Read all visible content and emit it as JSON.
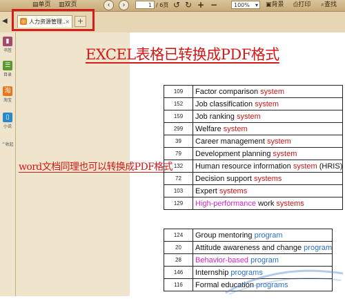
{
  "toolbar": {
    "single_page": "单页",
    "double_page": "双页",
    "page_input": "1",
    "page_total": "/ 6页",
    "zoom": "100%",
    "bg": "背景",
    "print": "打印",
    "find": "查找"
  },
  "tab": {
    "title": "人力资源管理...",
    "close": "×",
    "add": "+"
  },
  "sidebar": [
    {
      "label": "书签",
      "color": "#a24b6a"
    },
    {
      "label": "目录",
      "color": "#5a9a2a"
    },
    {
      "label": "淘宝",
      "color": "#e8761c"
    },
    {
      "label": "小说",
      "color": "#2a8ac9"
    },
    {
      "label": "收起"
    }
  ],
  "doc": {
    "title": "EXCEL表格已转换成PDF格式",
    "side_note": "word文档同理也可以转换成PDF格式"
  },
  "table1": [
    {
      "n": "109",
      "parts": [
        [
          "Factor comparison ",
          ""
        ],
        [
          "system",
          "red"
        ]
      ]
    },
    {
      "n": "152",
      "parts": [
        [
          "Job classification ",
          ""
        ],
        [
          "system",
          "red"
        ]
      ]
    },
    {
      "n": "159",
      "parts": [
        [
          "Job ranking ",
          ""
        ],
        [
          "system",
          "red"
        ]
      ]
    },
    {
      "n": "299",
      "parts": [
        [
          "Welfare ",
          ""
        ],
        [
          "system",
          "red"
        ]
      ]
    },
    {
      "n": "39",
      "parts": [
        [
          "Career management ",
          ""
        ],
        [
          "system",
          "red"
        ]
      ]
    },
    {
      "n": "79",
      "parts": [
        [
          "Development planning ",
          ""
        ],
        [
          "system",
          "red"
        ]
      ]
    },
    {
      "n": "132",
      "parts": [
        [
          "Human resource information ",
          ""
        ],
        [
          "system",
          "red"
        ],
        [
          " (HRIS)",
          ""
        ]
      ]
    },
    {
      "n": "72",
      "parts": [
        [
          "Decision support ",
          ""
        ],
        [
          "systems",
          "red"
        ]
      ]
    },
    {
      "n": "103",
      "parts": [
        [
          "Expert ",
          ""
        ],
        [
          "systems",
          "red"
        ]
      ]
    },
    {
      "n": "129",
      "parts": [
        [
          "High-performance",
          "mag"
        ],
        [
          " work ",
          ""
        ],
        [
          "systems",
          "red"
        ]
      ]
    }
  ],
  "table2": [
    {
      "n": "124",
      "parts": [
        [
          "Group mentoring ",
          ""
        ],
        [
          "program",
          "blue"
        ]
      ]
    },
    {
      "n": "20",
      "parts": [
        [
          "Attitude awareness and change ",
          ""
        ],
        [
          "program",
          "blue"
        ]
      ]
    },
    {
      "n": "28",
      "parts": [
        [
          "Behavior-based",
          "mag"
        ],
        [
          " program",
          "blue"
        ]
      ]
    },
    {
      "n": "146",
      "parts": [
        [
          "Internship ",
          ""
        ],
        [
          "programs",
          "blue"
        ]
      ]
    },
    {
      "n": "116",
      "parts": [
        [
          "Formal education ",
          ""
        ],
        [
          "programs",
          "blue"
        ]
      ]
    }
  ]
}
